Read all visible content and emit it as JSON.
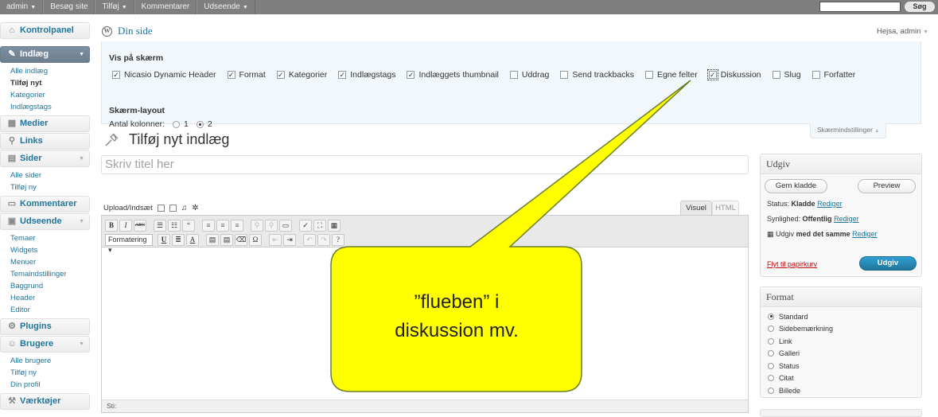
{
  "adminbar": {
    "items": [
      "admin",
      "Besøg site",
      "Tilføj",
      "Kommentarer",
      "Udseende"
    ],
    "search_button": "Søg"
  },
  "sidebar": {
    "dashboard": "Kontrolpanel",
    "posts": "Indlæg",
    "posts_sub": [
      "Alle indlæg",
      "Tilføj nyt",
      "Kategorier",
      "Indlægstags"
    ],
    "media": "Medier",
    "links": "Links",
    "pages": "Sider",
    "pages_sub": [
      "Alle sider",
      "Tilføj ny"
    ],
    "comments": "Kommentarer",
    "appearance": "Udseende",
    "appearance_sub": [
      "Temaer",
      "Widgets",
      "Menuer",
      "Temaindstillinger",
      "Baggrund",
      "Header",
      "Editor"
    ],
    "plugins": "Plugins",
    "users": "Brugere",
    "users_sub": [
      "Alle brugere",
      "Tilføj ny",
      "Din profil"
    ],
    "tools": "Værktøjer"
  },
  "header": {
    "site_name": "Din side",
    "howdy": "Hejsa, admin"
  },
  "screen_options": {
    "title": "Vis på skærm",
    "checkboxes": [
      {
        "label": "Nicasio Dynamic Header",
        "checked": true
      },
      {
        "label": "Format",
        "checked": true
      },
      {
        "label": "Kategorier",
        "checked": true
      },
      {
        "label": "Indlægstags",
        "checked": true
      },
      {
        "label": "Indlæggets thumbnail",
        "checked": true
      },
      {
        "label": "Uddrag",
        "checked": false
      },
      {
        "label": "Send trackbacks",
        "checked": false
      },
      {
        "label": "Egne felter",
        "checked": false
      },
      {
        "label": "Diskussion",
        "checked": true
      },
      {
        "label": "Slug",
        "checked": false
      },
      {
        "label": "Forfatter",
        "checked": false
      }
    ],
    "layout_title": "Skærm-layout",
    "columns_label": "Antal kolonner:",
    "col_1": "1",
    "col_2": "2",
    "toggle_link": "Skærmindstillinger"
  },
  "main": {
    "page_title": "Tilføj nyt indlæg",
    "title_placeholder": "Skriv titel her",
    "upload_label": "Upload/Indsæt",
    "tab_visual": "Visuel",
    "tab_html": "HTML",
    "format_select": "Formatering",
    "path_label": "Sti:"
  },
  "publish": {
    "title": "Udgiv",
    "save_draft": "Gem kladde",
    "preview": "Preview",
    "status_label": "Status:",
    "status_value": "Kladde",
    "visibility_label": "Synlighed:",
    "visibility_value": "Offentlig",
    "publish_when_1": "Udgiv",
    "publish_when_2": "med det samme",
    "edit": "Rediger",
    "trash": "Flyt til papirkurv",
    "publish_button": "Udgiv"
  },
  "format_box": {
    "title": "Format",
    "options": [
      "Standard",
      "Sidebemærkning",
      "Link",
      "Galleri",
      "Status",
      "Citat",
      "Billede"
    ],
    "selected": "Standard"
  },
  "callout": {
    "line1": "”flueben” i",
    "line2": "diskussion  mv."
  }
}
